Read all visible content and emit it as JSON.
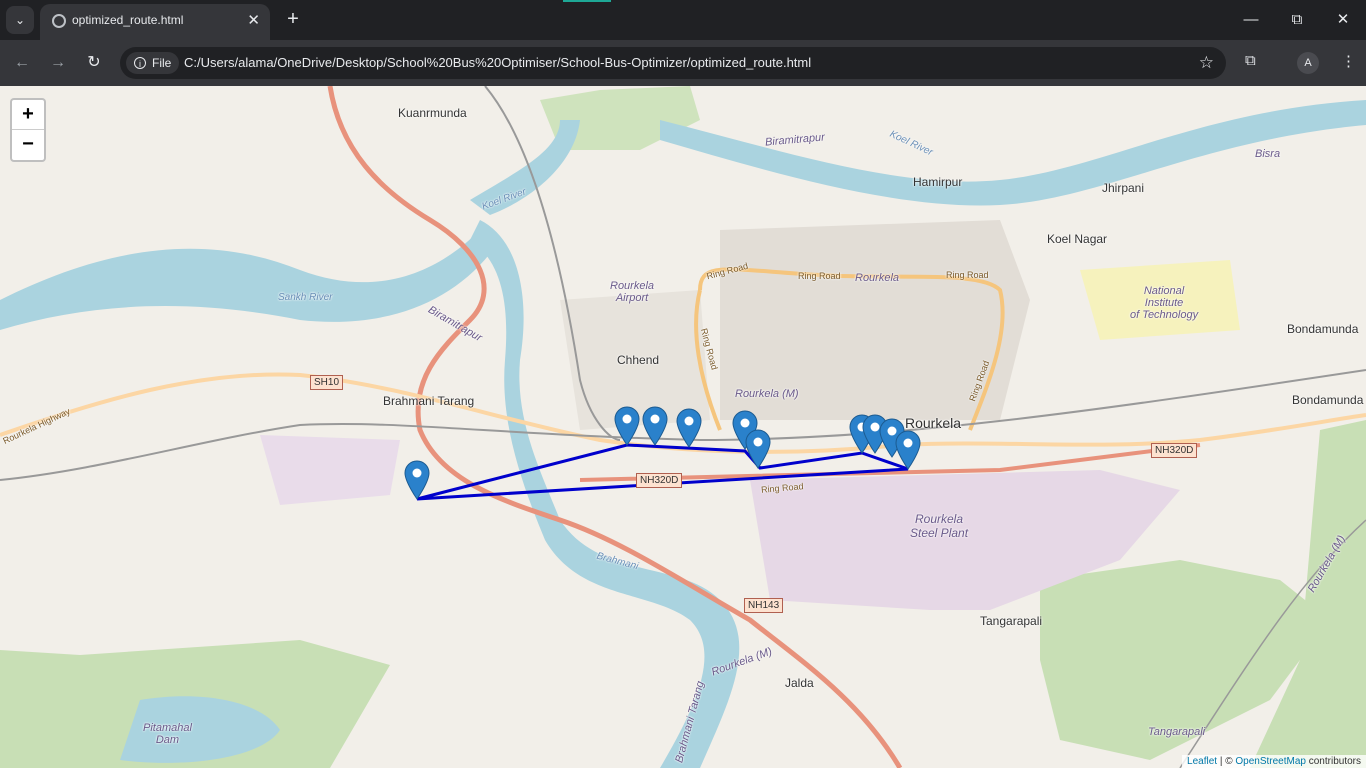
{
  "browser": {
    "tab_title": "optimized_route.html",
    "tab_icon": "globe-icon",
    "address_chip": "File",
    "url": "C:/Users/alama/OneDrive/Desktop/School%20Bus%20Optimiser/School-Bus-Optimizer/optimized_route.html",
    "profile_initial": "A"
  },
  "map": {
    "zoom_in": "+",
    "zoom_out": "−",
    "attribution_leaflet": "Leaflet",
    "attribution_sep": "| ©",
    "attribution_osm": "OpenStreetMap",
    "attribution_tail": "contributors",
    "route_color": "#0000cc",
    "marker_color": "#2a81cb",
    "place_labels": {
      "kuanrmunda": "Kuanrmunda",
      "hamirpur": "Hamirpur",
      "jhirpani": "Jhirpani",
      "koel_nagar": "Koel Nagar",
      "bondamunda_1": "Bondamunda",
      "bondamunda_2": "Bondamunda",
      "chhend": "Chhend",
      "brahmani_tarang": "Brahmani Tarang",
      "rourkela": "Rourkela",
      "tangarapali": "Tangarapali",
      "jalda": "Jalda",
      "tangarapali_italic": "Tangarapali",
      "rourkela_airport": "Rourkela\nAirport",
      "nit": "National\nInstitute\nof Technology",
      "steel_plant": "Rourkela\nSteel Plant",
      "pitamahal_dam": "Pitamahal\nDam",
      "biramitrapur_1": "Biramitrapur",
      "biramitrapur_2": "Biramitrapur",
      "rourkela_m_1": "Rourkela (M)",
      "rourkela_m_2": "Rourkela (M)",
      "rourkela_m_3": "Rourkela (M)",
      "rourkela_italic": "Rourkela",
      "isra": "Bisra",
      "brahmani_tarang_vert": "Brahmani Tarang"
    },
    "water_labels": {
      "koel_river_1": "Koel River",
      "koel_river_2": "Koel River",
      "sankh_river": "Sankh River",
      "brahmani": "Brahmani"
    },
    "road_labels": {
      "ring_road_1": "Ring Road",
      "ring_road_2": "Ring Road",
      "ring_road_3": "Ring Road",
      "ring_road_4": "Ring Road",
      "ring_road_5": "Ring Road",
      "ring_road_6": "Ring Road",
      "rourkela_highway": "Rourkela Highway"
    },
    "shields": {
      "sh10": "SH10",
      "nh320d_1": "NH320D",
      "nh320d_2": "NH320D",
      "nh143": "NH143"
    }
  }
}
